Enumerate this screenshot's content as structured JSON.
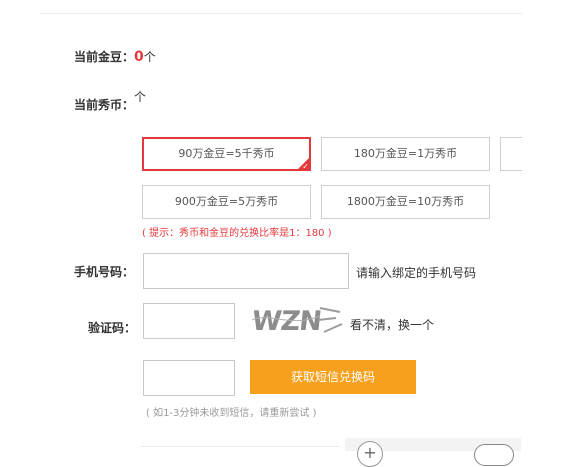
{
  "balance": {
    "gold_label": "当前金豆：",
    "gold_value": "0",
    "gold_unit": "个",
    "coin_label": "当前秀币：",
    "coin_unit": "个"
  },
  "options": [
    {
      "label": "90万金豆=5千秀币",
      "selected": true
    },
    {
      "label": "180万金豆=1万秀币",
      "selected": false
    },
    {
      "label": "",
      "selected": false
    },
    {
      "label": "900万金豆=5万秀币",
      "selected": false
    },
    {
      "label": "1800万金豆=10万秀币",
      "selected": false
    }
  ],
  "ratio_hint": "( 提示：秀币和金豆的兑换比率是1：180 )",
  "phone": {
    "label": "手机号码：",
    "value": "",
    "note": "请输入绑定的手机号码"
  },
  "captcha": {
    "label": "验证码：",
    "value": "",
    "image_text": "WZN",
    "refresh_text": "看不清，换一个"
  },
  "sms": {
    "value": "",
    "button_label": "获取短信兑换码",
    "note": "( 如1-3分钟未收到短信，请重新尝试 )"
  },
  "colors": {
    "accent_red": "#e4393c",
    "button_orange": "#f7a01d"
  }
}
